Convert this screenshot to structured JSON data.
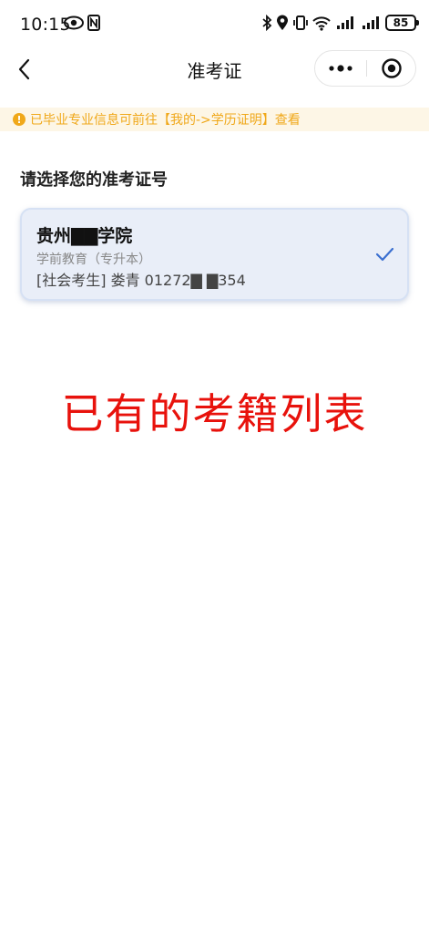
{
  "status_bar": {
    "time": "10:15",
    "battery": "85"
  },
  "nav": {
    "title": "准考证"
  },
  "notice": {
    "text": "已毕业专业信息可前往【我的->学历证明】查看"
  },
  "section": {
    "title": "请选择您的准考证号"
  },
  "ticket": {
    "school": "贵州▇▇学院",
    "major": "学前教育（专升本）",
    "candidate": "[社会考生] 娄青 01272▇ ▇354"
  },
  "annotation": {
    "text": "已有的考籍列表"
  },
  "colors": {
    "accent": "#3a6fd0",
    "notice_text": "#f0a81a",
    "notice_bg": "#fdf6e6",
    "card_bg": "#e9eef8",
    "annotation": "#e8120c"
  },
  "icons": {
    "back": "chevron-left-icon",
    "more": "more-dots-icon",
    "close": "target-icon",
    "check": "check-icon",
    "notice": "info-icon"
  }
}
